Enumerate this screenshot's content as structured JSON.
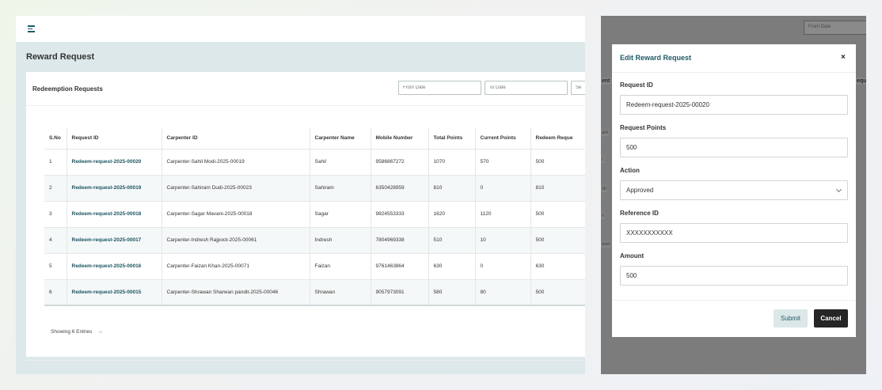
{
  "page": {
    "title": "Reward Request",
    "card_title": "Redeemption Requests",
    "from_date_placeholder": "From Date",
    "to_date_placeholder": "To Date",
    "search_placeholder": "Se",
    "showing_text": "Showing 6 Entries",
    "arrow_glyph": "→"
  },
  "table": {
    "headers": [
      "S.No",
      "Request ID",
      "Carpenter ID",
      "Carpenter Name",
      "Mobile Number",
      "Total Points",
      "Current Points",
      "Redeem Reque"
    ],
    "rows": [
      [
        "1",
        "Redeem-request-2025-00020",
        "Carpenter-Sahil Modi-2025-00019",
        "Sahil",
        "9586867272",
        "1070",
        "570",
        "500"
      ],
      [
        "2",
        "Redeem-request-2025-00019",
        "Carpenter-Sahiram Dudi-2025-00023",
        "Sahiram",
        "6350428959",
        "810",
        "0",
        "810"
      ],
      [
        "3",
        "Redeem-request-2025-00018",
        "Carpenter-Sagar Mavani-2025-00018",
        "Sagar",
        "9824553333",
        "1620",
        "1120",
        "500"
      ],
      [
        "4",
        "Redeem-request-2025-00017",
        "Carpenter-Indresh Rajpoot-2025-00061",
        "Indresh",
        "7804969338",
        "510",
        "10",
        "500"
      ],
      [
        "5",
        "Redeem-request-2025-00016",
        "Carpenter-Faizan Khan-2025-00071",
        "Faizan",
        "9761463864",
        "630",
        "0",
        "630"
      ],
      [
        "6",
        "Redeem-request-2025-00015",
        "Carpenter-Shrawan Sharwan pandit-2025-00046",
        "Shrawan",
        "9057973091",
        "580",
        "80",
        "500"
      ]
    ]
  },
  "right_panel": {
    "from_date_placeholder": "From Date",
    "peek_header_left": "ent",
    "peek_header_right": "equ",
    "peek_rows": [
      "am",
      "r",
      "sh",
      "n",
      "wan"
    ]
  },
  "modal": {
    "title": "Edit Reward Request",
    "close_glyph": "×",
    "request_id_label": "Request ID",
    "request_id_value": "Redeem-request-2025-00020",
    "request_points_label": "Request Points",
    "request_points_value": "500",
    "action_label": "Action",
    "action_value": "Approved",
    "reference_id_label": "Reference ID",
    "reference_id_value": "XXXXXXXXXXX",
    "amount_label": "Amount",
    "amount_value": "500",
    "submit_label": "Submit",
    "cancel_label": "Cancel"
  },
  "colors": {
    "accent": "#1d5a66",
    "link": "#1a5360",
    "content_bg": "#dde8ea",
    "overlay": "#7c7c7c",
    "cancel_bg": "#262626"
  }
}
